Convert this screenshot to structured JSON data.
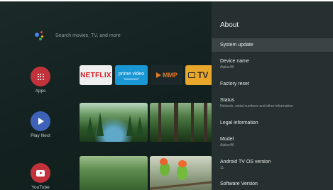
{
  "search": {
    "placeholder": "Search movies, TV, and more"
  },
  "rail": [
    {
      "label": "Apps"
    },
    {
      "label": "Play Next"
    },
    {
      "label": "YouTube"
    }
  ],
  "apps": {
    "netflix": "NETFLIX",
    "prime_line1": "prime video",
    "mmp": "MMP",
    "tv": "TV"
  },
  "panel": {
    "title": "About",
    "items": [
      {
        "label": "System update"
      },
      {
        "label": "Device name",
        "value": "Aiplus4K"
      },
      {
        "label": "Factory reset"
      },
      {
        "label": "Status",
        "value": "Network, serial numbers and other information"
      },
      {
        "label": "Legal information"
      },
      {
        "label": "Model",
        "value": "Aiplus4K"
      },
      {
        "label": "Android TV OS version",
        "value": "11"
      },
      {
        "label": "Software Version"
      }
    ]
  },
  "colors": {
    "panel_bg": "#263030",
    "selected_bg": "#3a4444",
    "apps_icon": "#c2323b",
    "playnext_icon": "#3e62b8",
    "youtube_icon": "#c2323b",
    "netflix_red": "#d81f26",
    "prime_blue": "#1a98d5"
  }
}
